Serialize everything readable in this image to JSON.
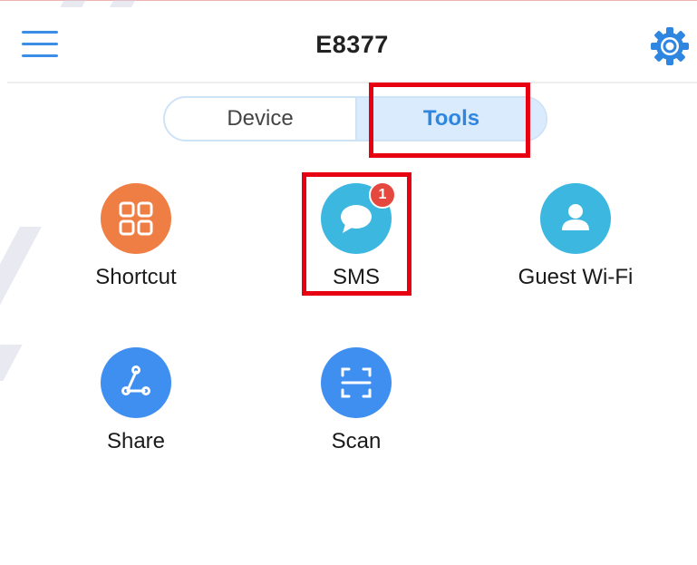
{
  "header": {
    "title": "E8377",
    "menu_icon": "hamburger-menu-icon",
    "settings_icon": "gear-icon"
  },
  "tabs": [
    {
      "label": "Device",
      "active": false
    },
    {
      "label": "Tools",
      "active": true
    }
  ],
  "tools": [
    {
      "label": "Shortcut",
      "icon": "grid-shortcut-icon",
      "color": "#ef7e45"
    },
    {
      "label": "SMS",
      "icon": "chat-bubble-icon",
      "color": "#3cb7e0",
      "badge": "1"
    },
    {
      "label": "Guest Wi-Fi",
      "icon": "user-icon",
      "color": "#3cb7e0"
    },
    {
      "label": "Share",
      "icon": "share-icon",
      "color": "#3f8ff0"
    },
    {
      "label": "Scan",
      "icon": "scan-icon",
      "color": "#3f8ff0"
    }
  ],
  "colors": {
    "accent": "#2f86e0",
    "badge": "#e5483f",
    "highlight_box": "#e60012"
  }
}
